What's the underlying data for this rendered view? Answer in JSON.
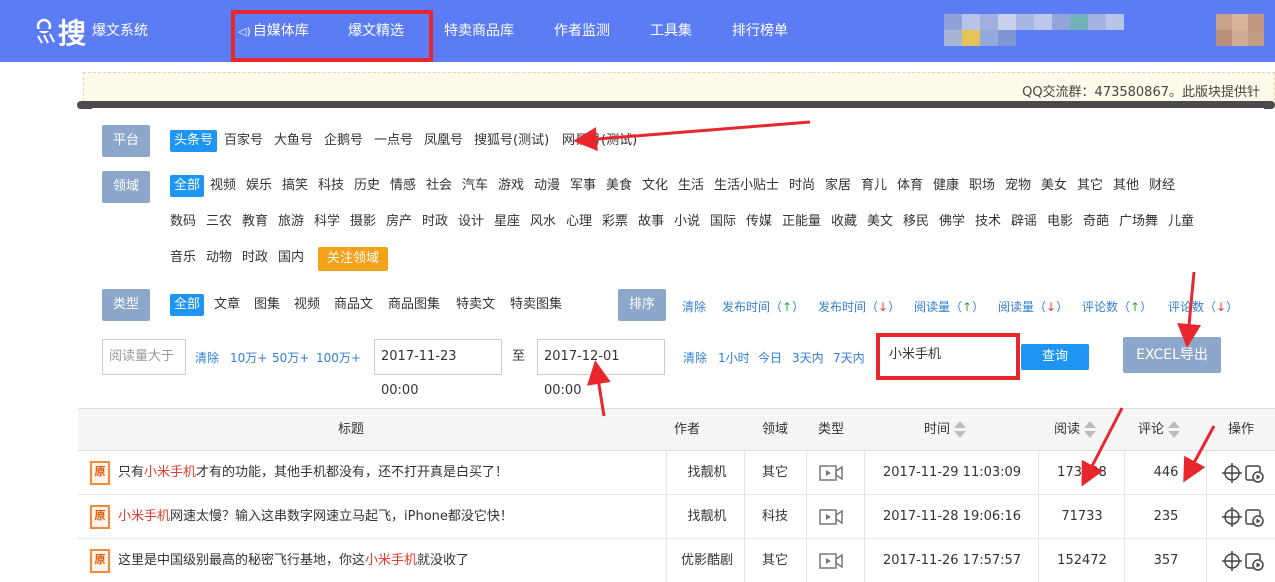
{
  "header": {
    "brand": "爆文系统",
    "logo_glyph": "搜",
    "nav": [
      {
        "label": "自媒体库",
        "speaker": "🔊"
      },
      {
        "label": "爆文精选"
      },
      {
        "label": "特卖商品库"
      },
      {
        "label": "作者监测"
      },
      {
        "label": "工具集"
      },
      {
        "label": "排行榜单"
      }
    ]
  },
  "notice": {
    "text": "QQ交流群：473580867。此版块提供针"
  },
  "filter": {
    "platform": {
      "label": "平台",
      "options": [
        "头条号",
        "百家号",
        "大鱼号",
        "企鹅号",
        "一点号",
        "凤凰号",
        "搜狐号(测试)",
        "网易号(测试)"
      ],
      "selected": "头条号"
    },
    "field": {
      "label": "领域",
      "rows": [
        [
          "全部",
          "视频",
          "娱乐",
          "搞笑",
          "科技",
          "历史",
          "情感",
          "社会",
          "汽车",
          "游戏",
          "动漫",
          "军事",
          "美食",
          "文化",
          "生活",
          "生活小贴士",
          "时尚",
          "家居",
          "育儿",
          "体育",
          "健康",
          "职场",
          "宠物",
          "美女",
          "其它",
          "其他",
          "财经"
        ],
        [
          "数码",
          "三农",
          "教育",
          "旅游",
          "科学",
          "摄影",
          "房产",
          "时政",
          "设计",
          "星座",
          "风水",
          "心理",
          "彩票",
          "故事",
          "小说",
          "国际",
          "传媒",
          "正能量",
          "收藏",
          "美文",
          "移民",
          "佛学",
          "技术",
          "辟谣",
          "电影",
          "奇葩",
          "广场舞",
          "儿童"
        ],
        [
          "音乐",
          "动物",
          "时政",
          "国内"
        ]
      ],
      "follow_label": "关注领域",
      "selected": "全部"
    },
    "type": {
      "label": "类型",
      "options": [
        "全部",
        "文章",
        "图集",
        "视频",
        "商品文",
        "商品图集",
        "特卖文",
        "特卖图集"
      ],
      "selected": "全部"
    },
    "sort": {
      "label": "排序",
      "clear": "清除",
      "options": [
        {
          "text": "发布时间",
          "dir": "↑"
        },
        {
          "text": "发布时间",
          "dir": "↓"
        },
        {
          "text": "阅读量",
          "dir": "↑"
        },
        {
          "text": "阅读量",
          "dir": "↓"
        },
        {
          "text": "评论数",
          "dir": "↑"
        },
        {
          "text": "评论数",
          "dir": "↓"
        }
      ]
    },
    "read_filter": {
      "placeholder": "阅读量大于",
      "clear": "清除",
      "quick": [
        "10万+",
        "50万+",
        "100万+"
      ]
    },
    "date_range": {
      "start": "2017-11-23 00:00",
      "separator": "至",
      "end": "2017-12-01 00:00",
      "clear": "清除",
      "quick": [
        "1小时",
        "今日",
        "3天内",
        "7天内"
      ]
    },
    "search": {
      "value": "小米手机",
      "button": "查询"
    },
    "excel_button": "EXCEL导出"
  },
  "table": {
    "columns": [
      "标题",
      "作者",
      "领域",
      "类型",
      "时间",
      "阅读",
      "评论",
      "操作"
    ],
    "badge": "原",
    "rows": [
      {
        "title_pre": "只有",
        "title_hl": "小米手机",
        "title_post": "才有的功能，其他手机都没有，还不打开真是白买了！",
        "author": "找靓机",
        "field": "其它",
        "time": "2017-11-29 11:03:09",
        "reads": "173938",
        "comments": "446"
      },
      {
        "title_pre": "",
        "title_hl": "小米手机",
        "title_post": "网速太慢？输入这串数字网速立马起飞，iPhone都没它快！",
        "author": "找靓机",
        "field": "科技",
        "time": "2017-11-28 19:06:16",
        "reads": "71733",
        "comments": "235"
      },
      {
        "title_pre": "这里是中国级别最高的秘密飞行基地，你这",
        "title_hl": "小米手机",
        "title_post": "就没收了",
        "author": "优影酷剧",
        "field": "其它",
        "time": "2017-11-26 17:57:57",
        "reads": "152472",
        "comments": "357"
      }
    ]
  },
  "colors": {
    "header": "#5b7cf5",
    "accent": "#1e95f4",
    "tag": "#8ca7c9",
    "follow": "#f6a11a",
    "annotation": "#e8262d"
  }
}
